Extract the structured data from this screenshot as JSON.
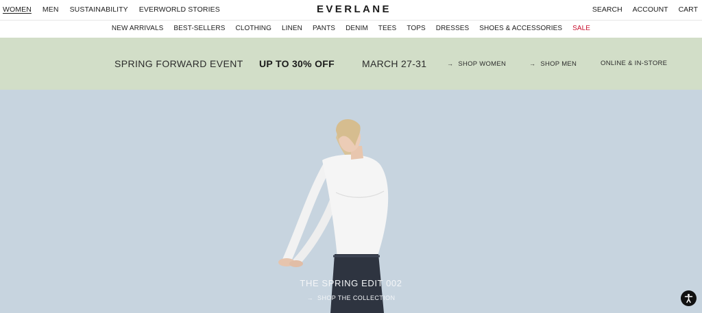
{
  "header": {
    "primary_nav": [
      "WOMEN",
      "MEN",
      "SUSTAINABILITY",
      "EVERWORLD STORIES"
    ],
    "logo": "EVERLANE",
    "utility_nav": [
      "SEARCH",
      "ACCOUNT",
      "CART"
    ]
  },
  "category_nav": [
    "NEW ARRIVALS",
    "BEST-SELLERS",
    "CLOTHING",
    "LINEN",
    "PANTS",
    "DENIM",
    "TEES",
    "TOPS",
    "DRESSES",
    "SHOES & ACCESSORIES",
    "SALE"
  ],
  "promo": {
    "event": "SPRING FORWARD EVENT",
    "discount": "UP TO 30% OFF",
    "dates": "MARCH 27-31",
    "shop_women": "SHOP WOMEN",
    "shop_men": "SHOP MEN",
    "availability": "ONLINE & IN-STORE",
    "background": "#d2dec8"
  },
  "hero": {
    "title": "THE SPRING EDIT 002",
    "cta": "SHOP THE COLLECTION",
    "background": "#c7d4df"
  },
  "icons": {
    "arrow": "→",
    "accessibility": "accessibility-icon"
  },
  "colors": {
    "sale": "#c8102e",
    "text": "#1b1b1b"
  }
}
